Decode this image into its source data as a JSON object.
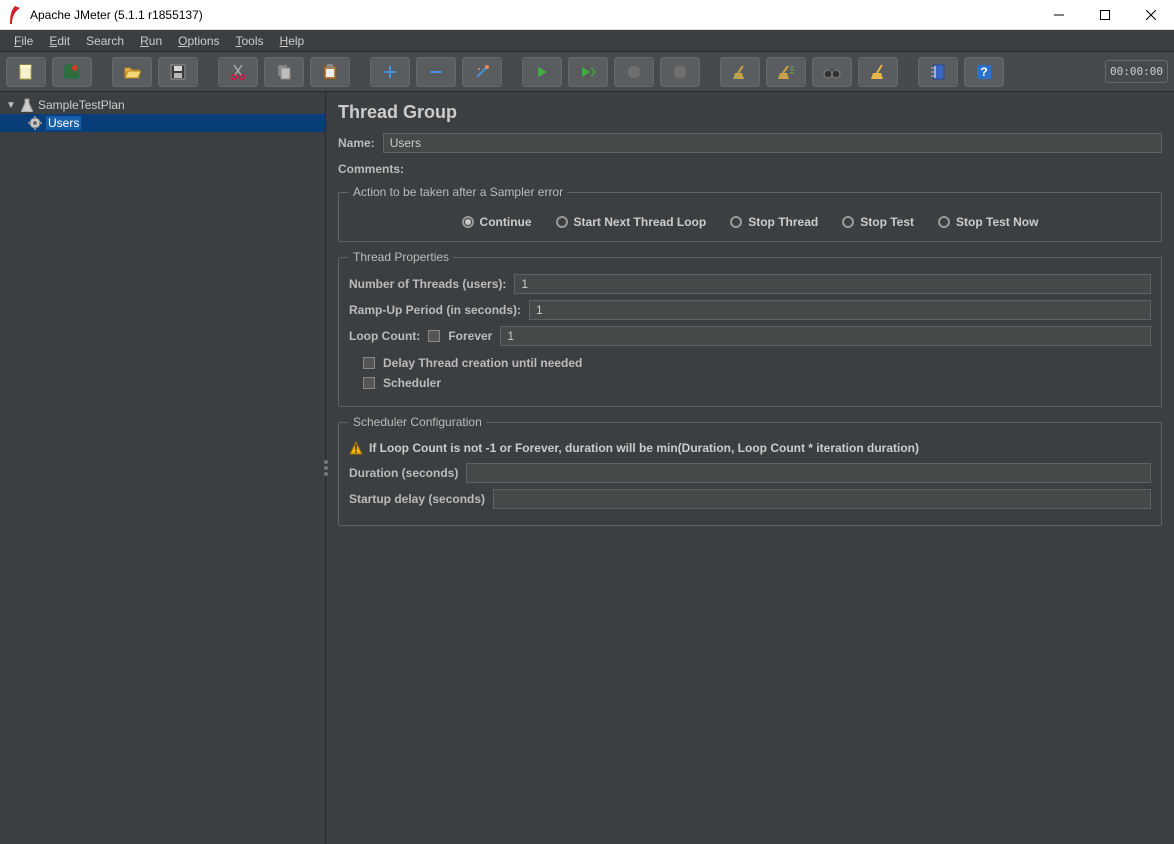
{
  "window": {
    "title": "Apache JMeter (5.1.1 r1855137)"
  },
  "menus": {
    "file": "File",
    "edit": "Edit",
    "search": "Search",
    "run": "Run",
    "options": "Options",
    "tools": "Tools",
    "help": "Help"
  },
  "toolbar": {
    "timer": "00:00:00"
  },
  "tree": {
    "root": {
      "label": "SampleTestPlan"
    },
    "child": {
      "label": "Users"
    }
  },
  "panel": {
    "title": "Thread Group",
    "name_label": "Name:",
    "name_value": "Users",
    "comments_label": "Comments:",
    "sampler_error": {
      "legend": "Action to be taken after a Sampler error",
      "continue": "Continue",
      "start_next": "Start Next Thread Loop",
      "stop_thread": "Stop Thread",
      "stop_test": "Stop Test",
      "stop_test_now": "Stop Test Now"
    },
    "thread_props": {
      "legend": "Thread Properties",
      "num_threads_label": "Number of Threads (users):",
      "num_threads_value": "1",
      "ramp_label": "Ramp-Up Period (in seconds):",
      "ramp_value": "1",
      "loop_label": "Loop Count:",
      "forever_label": "Forever",
      "loop_value": "1",
      "delay_label": "Delay Thread creation until needed",
      "scheduler_label": "Scheduler"
    },
    "sched": {
      "legend": "Scheduler Configuration",
      "warning": "If Loop Count is not -1 or Forever, duration will be min(Duration, Loop Count * iteration duration)",
      "duration_label": "Duration (seconds)",
      "startup_label": "Startup delay (seconds)"
    }
  }
}
